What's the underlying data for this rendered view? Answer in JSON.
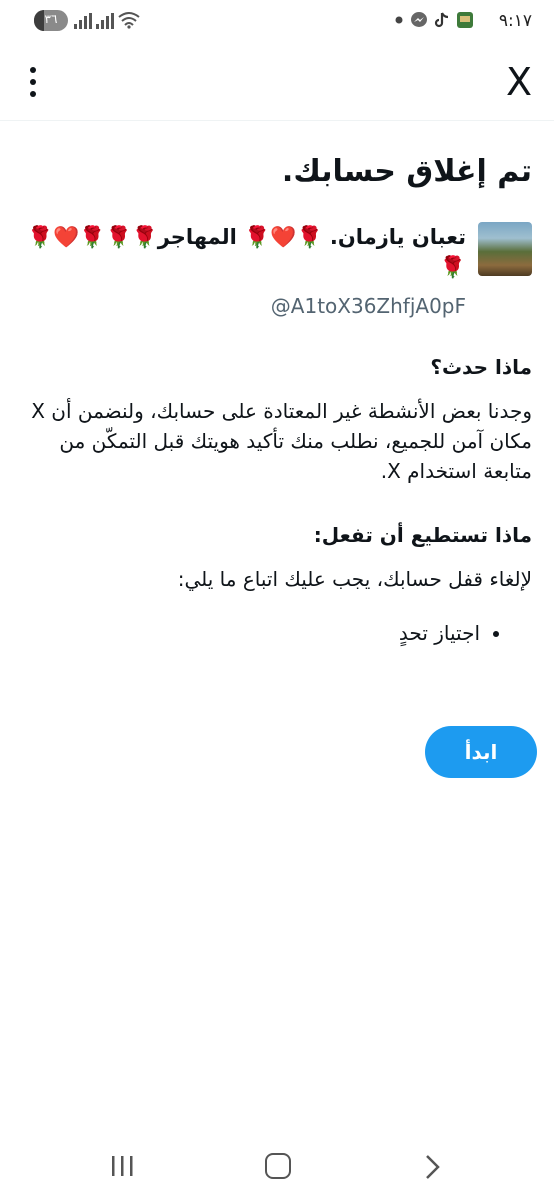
{
  "status_bar": {
    "time": "٩:١٧",
    "battery_level": "٣٦",
    "icons": [
      "dot-icon",
      "messenger-icon",
      "tiktok-icon",
      "app-icon",
      "wifi-icon",
      "signal-icon",
      "signal-icon"
    ]
  },
  "app_bar": {
    "close_label": "X"
  },
  "page": {
    "title": "تم إغلاق حسابك.",
    "profile": {
      "display_name": "تعبان يازمان. 🌹❤️🌹 المهاجر🌹🌹🌹❤️🌹🌹",
      "handle": "@A1toX36ZhfjA0pF"
    },
    "what_happened": {
      "heading": "ماذا حدث؟",
      "body": "وجدنا بعض الأنشطة غير المعتادة على حسابك، ولنضمن أن X مكان آمن للجميع، نطلب منك تأكيد هويتك قبل التمكّن من متابعة استخدام X."
    },
    "what_to_do": {
      "heading": "ماذا تستطيع أن تفعل:",
      "body": "لإلغاء قفل حسابك، يجب عليك اتباع ما يلي:",
      "steps": [
        "اجتياز تحدٍ"
      ]
    },
    "start_button": "ابدأ"
  },
  "colors": {
    "accent": "#1d9bf0",
    "text": "#0f1419",
    "secondary_text": "#536471"
  }
}
